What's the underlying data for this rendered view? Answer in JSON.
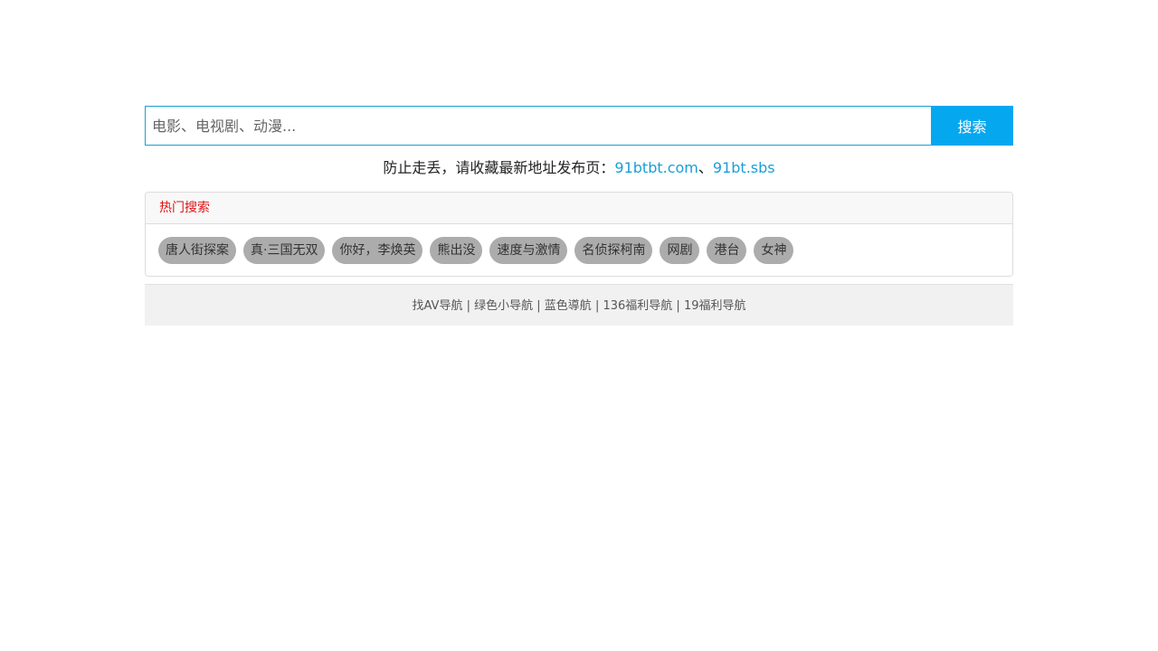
{
  "search": {
    "placeholder": "电影、电视剧、动漫...",
    "button_label": "搜索"
  },
  "notice": {
    "text": "防止走丢，请收藏最新地址发布页：",
    "link1": "91btbt.com",
    "separator": "、",
    "link2": "91bt.sbs"
  },
  "hot": {
    "title": "热门搜索",
    "tags": [
      "唐人街探案",
      "真·三国无双",
      "你好，李焕英",
      "熊出没",
      "速度与激情",
      "名侦探柯南",
      "网剧",
      "港台",
      "女神"
    ]
  },
  "footer": {
    "links": [
      "找AV导航",
      "绿色小导航",
      "蓝色導航",
      "136福利导航",
      "19福利导航"
    ],
    "separator": " | "
  },
  "colors": {
    "accent": "#05a8ef",
    "link": "#1a9ed6",
    "hot_title": "#e01414",
    "tag_bg": "#acacac"
  }
}
